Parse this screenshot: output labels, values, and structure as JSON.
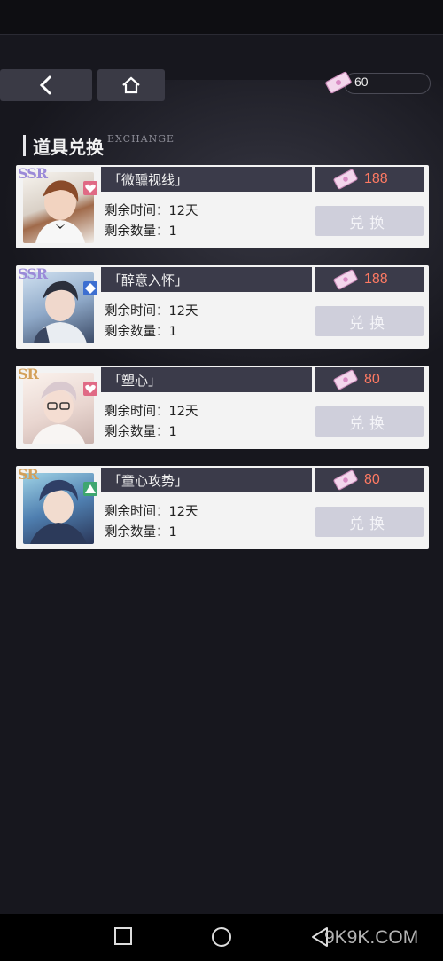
{
  "header": {
    "currency_value": "60"
  },
  "section": {
    "title": "道具兑换",
    "subtitle": "EXCHANGE"
  },
  "items": [
    {
      "rarity": "SSR",
      "name": "「微醺视线」",
      "price": "188",
      "time_label": "剩余时间：12天",
      "qty_label": "剩余数量：1",
      "button": "兑换",
      "badge": "heart-icon",
      "badge_color": "#e06a85"
    },
    {
      "rarity": "SSR",
      "name": "「醉意入怀」",
      "price": "188",
      "time_label": "剩余时间：12天",
      "qty_label": "剩余数量：1",
      "button": "兑换",
      "badge": "diamond-icon",
      "badge_color": "#3d6fd1"
    },
    {
      "rarity": "SR",
      "name": "「塑心」",
      "price": "80",
      "time_label": "剩余时间：12天",
      "qty_label": "剩余数量：1",
      "button": "兑换",
      "badge": "heart-icon",
      "badge_color": "#e06a85"
    },
    {
      "rarity": "SR",
      "name": "「童心攻势」",
      "price": "80",
      "time_label": "剩余时间：12天",
      "qty_label": "剩余数量：1",
      "button": "兑换",
      "badge": "triangle-icon",
      "badge_color": "#3ea66f"
    }
  ],
  "watermark": "9K9K.COM"
}
